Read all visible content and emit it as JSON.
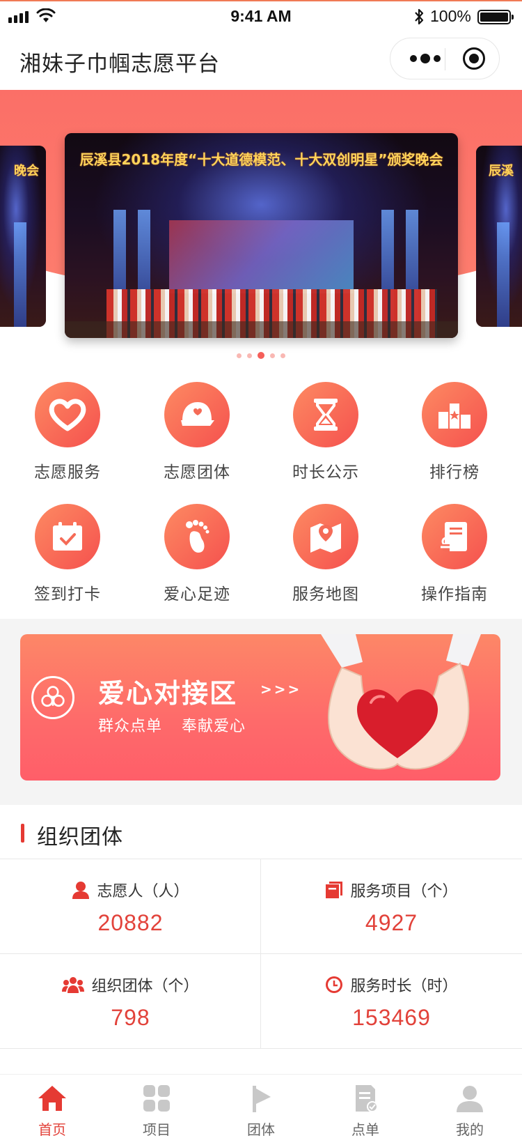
{
  "status_bar": {
    "time": "9:41 AM",
    "battery": "100%"
  },
  "nav": {
    "title": "湘妹子巾帼志愿平台"
  },
  "banner": {
    "slides": [
      {
        "caption": "晚会"
      },
      {
        "caption": "辰溪县2018年度“十大道德模范、十大双创明星”颁奖晚会"
      },
      {
        "caption": "辰溪"
      }
    ],
    "dot_count": 5,
    "active_dot": 3
  },
  "grid": {
    "items": [
      {
        "label": "志愿服务",
        "icon": "heart-icon"
      },
      {
        "label": "志愿团体",
        "icon": "cap-icon"
      },
      {
        "label": "时长公示",
        "icon": "hourglass-icon"
      },
      {
        "label": "排行榜",
        "icon": "podium-icon"
      },
      {
        "label": "签到打卡",
        "icon": "calendar-check-icon"
      },
      {
        "label": "爱心足迹",
        "icon": "footprint-icon"
      },
      {
        "label": "服务地图",
        "icon": "map-icon"
      },
      {
        "label": "操作指南",
        "icon": "guide-icon"
      }
    ]
  },
  "promo": {
    "title": "爱心对接区",
    "arrows": ">>>",
    "subtitle": "群众点单 奉献爱心"
  },
  "stats": {
    "heading": "组织团体",
    "items": [
      {
        "label": "志愿人（人）",
        "value": "20882",
        "icon": "person-icon"
      },
      {
        "label": "服务项目（个）",
        "value": "4927",
        "icon": "folder-icon"
      },
      {
        "label": "组织团体（个）",
        "value": "798",
        "icon": "group-icon"
      },
      {
        "label": "服务时长（时）",
        "value": "153469",
        "icon": "clock-icon"
      }
    ]
  },
  "tabs": [
    {
      "label": "首页",
      "icon": "home-icon",
      "active": true
    },
    {
      "label": "项目",
      "icon": "grid-icon",
      "active": false
    },
    {
      "label": "团体",
      "icon": "flag-icon",
      "active": false
    },
    {
      "label": "点单",
      "icon": "order-icon",
      "active": false
    },
    {
      "label": "我的",
      "icon": "user-icon",
      "active": false
    }
  ],
  "colors": {
    "accent": "#f5514e",
    "accent_light": "#fd8a62",
    "value_red": "#e2423a",
    "section_bg": "#f4f4f4"
  }
}
